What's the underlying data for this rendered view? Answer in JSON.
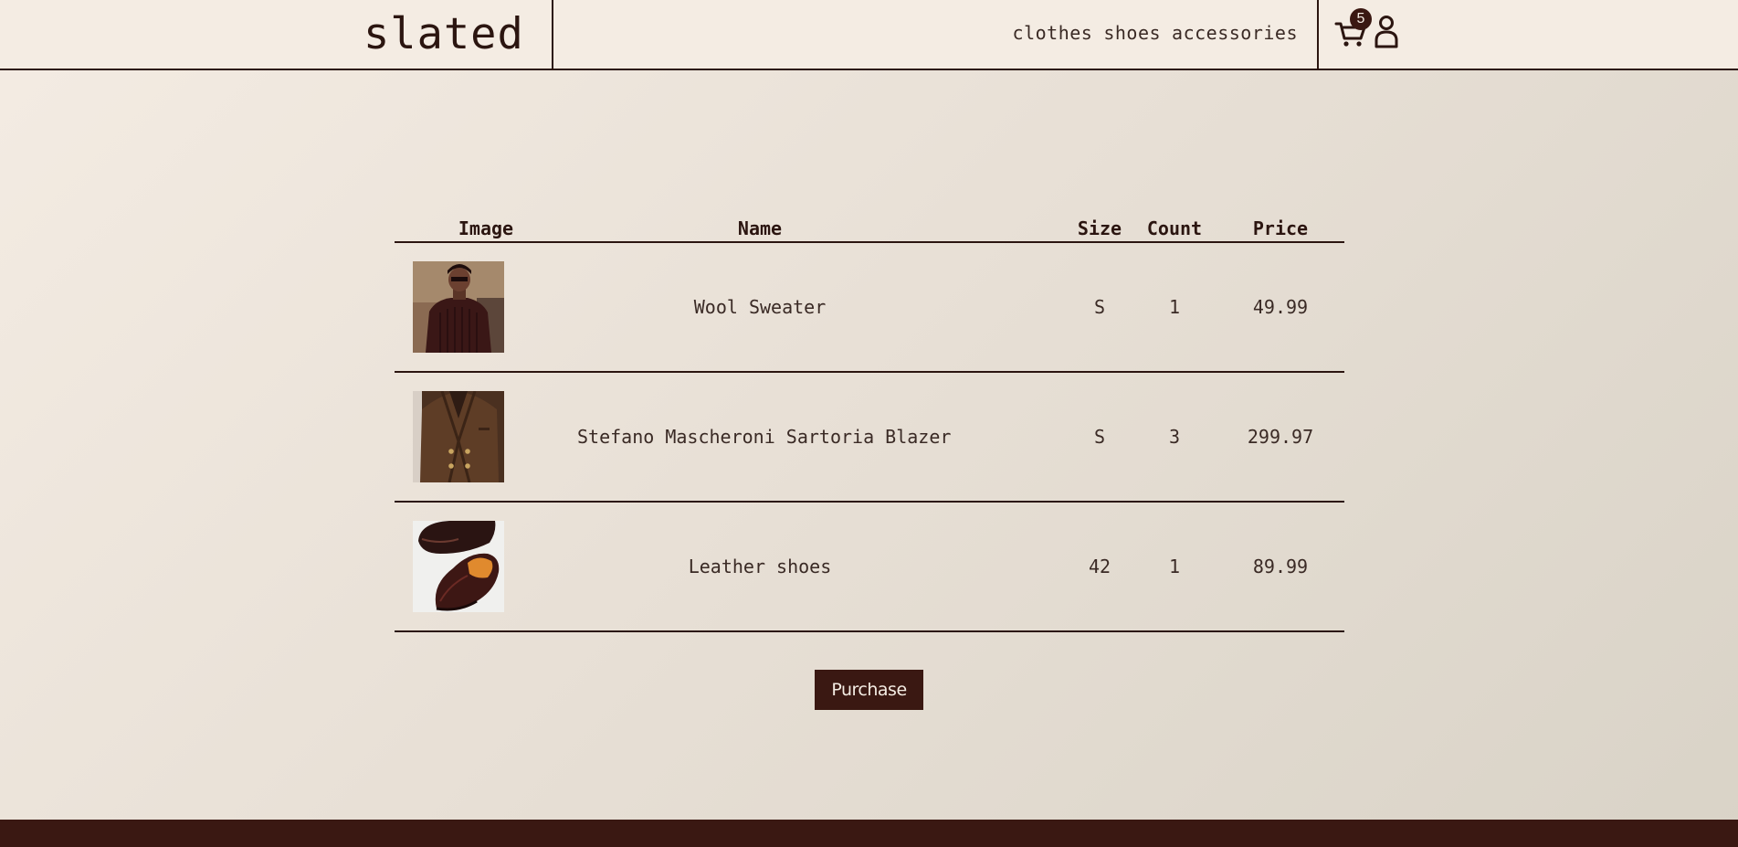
{
  "brand": {
    "logo": "slated"
  },
  "nav": {
    "links": [
      "clothes",
      "shoes",
      "accessories"
    ],
    "cart_count": "5",
    "cart_icon": "cart-icon",
    "user_icon": "user-icon"
  },
  "table": {
    "headers": {
      "image": "Image",
      "name": "Name",
      "size": "Size",
      "count": "Count",
      "price": "Price"
    },
    "rows": [
      {
        "image": "sweater-photo",
        "name": "Wool Sweater",
        "size": "S",
        "count": "1",
        "price": "49.99"
      },
      {
        "image": "blazer-photo",
        "name": "Stefano Mascheroni Sartoria Blazer",
        "size": "S",
        "count": "3",
        "price": "299.97"
      },
      {
        "image": "shoes-photo",
        "name": "Leather shoes",
        "size": "42",
        "count": "1",
        "price": "89.99"
      }
    ]
  },
  "actions": {
    "purchase_label": "Purchase"
  },
  "colors": {
    "accent": "#3a1812",
    "background": "#f4ece3",
    "text": "#2b1510"
  }
}
